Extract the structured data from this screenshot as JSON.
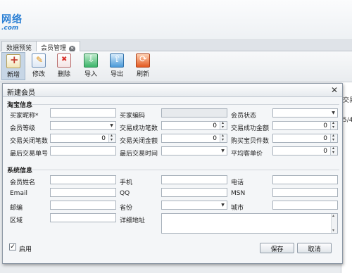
{
  "brand": {
    "logo_text": "网络",
    "logo_domain": ".com"
  },
  "tabs": [
    {
      "label": "数据预览"
    },
    {
      "label": "会员管理"
    }
  ],
  "toolbar": {
    "new_label": "新增",
    "edit_label": "修改",
    "delete_label": "删除",
    "import_label": "导入",
    "export_label": "导出",
    "refresh_label": "刷新"
  },
  "background": {
    "col_header_fragment": "交易",
    "cell_fragment": "5/4"
  },
  "dialog": {
    "title": "新建会员",
    "close_glyph": "✕",
    "taobao_section": "淘宝信息",
    "system_section": "系统信息",
    "fields": {
      "buyer_nick": "买家昵称*",
      "buyer_code": "买家编码",
      "member_status": "会员状态",
      "member_level": "会员等级",
      "success_trades": "交易成功笔数",
      "success_amount": "交易成功金额",
      "closed_trades": "交易关闭笔数",
      "closed_amount": "交易关闭金额",
      "items_bought": "购买宝贝件数",
      "last_trade_no": "最后交易单号",
      "last_trade_time": "最后交易时间",
      "avg_price": "平均客单价",
      "member_name": "会员姓名",
      "mobile": "手机",
      "phone": "电话",
      "email": "Email",
      "qq": "QQ",
      "msn": "MSN",
      "postcode": "邮编",
      "province": "省份",
      "city": "城市",
      "district": "区域",
      "address": "详细地址"
    },
    "values": {
      "success_trades": "0",
      "success_amount": "0",
      "closed_trades": "0",
      "closed_amount": "0",
      "items_bought": "0",
      "avg_price": "0"
    },
    "enabled_label": "启用",
    "enabled_checked": true,
    "save_label": "保存",
    "cancel_label": "取消"
  }
}
